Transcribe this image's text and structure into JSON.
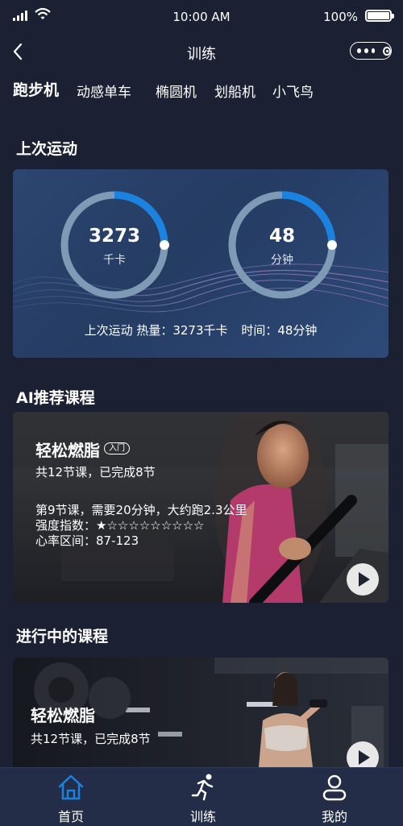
{
  "status": {
    "time": "10:00 AM",
    "battery": "100%"
  },
  "nav": {
    "title": "训练"
  },
  "categories": [
    {
      "label": "跑步机",
      "active": true
    },
    {
      "label": "动感单车",
      "active": false
    },
    {
      "label": "椭圆机",
      "active": false
    },
    {
      "label": "划船机",
      "active": false
    },
    {
      "label": "小飞鸟",
      "active": false
    }
  ],
  "last_workout": {
    "section_title": "上次运动",
    "calories": {
      "value": "3273",
      "unit": "千卡",
      "progress": 0.25
    },
    "duration": {
      "value": "48",
      "unit": "分钟",
      "progress": 0.25
    },
    "summary_calories": "上次运动 热量：3273千卡",
    "summary_time": "时间：48分钟"
  },
  "ai_recommend": {
    "section_title": "AI推荐课程",
    "course": {
      "title": "轻松燃脂",
      "level": "入门",
      "progress_text": "共12节课，已完成8节",
      "lesson_text": "第9节课，需要20分钟，大约跑2.3公里",
      "intensity_label": "强度指数：",
      "intensity_stars": "★☆☆☆☆☆☆☆☆☆",
      "intensity_rating": 1,
      "heart_rate": "心率区间：87-123"
    }
  },
  "in_progress": {
    "section_title": "进行中的课程",
    "course": {
      "title": "轻松燃脂",
      "progress_text": "共12节课，已完成8节"
    }
  },
  "tab_bar": [
    {
      "label": "首页",
      "icon": "home-icon",
      "active": true
    },
    {
      "label": "训练",
      "icon": "running-icon",
      "active": false
    },
    {
      "label": "我的",
      "icon": "user-icon",
      "active": false
    }
  ],
  "colors": {
    "accent": "#1a82e0",
    "ring_track": "#7e9ab4",
    "background": "#1b2133"
  }
}
